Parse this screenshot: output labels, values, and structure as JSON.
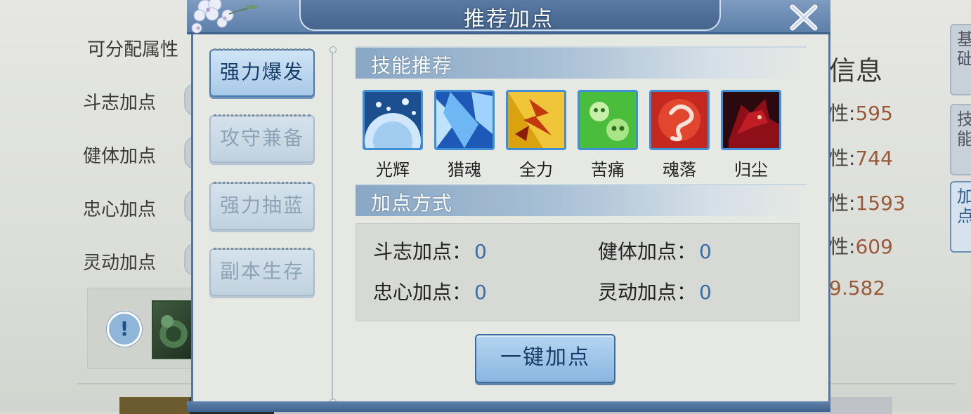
{
  "background": {
    "left_header": "可分配属性",
    "labels": [
      "斗志加点",
      "健体加点",
      "忠心加点",
      "灵动加点"
    ],
    "info_title": "信息",
    "stats": [
      {
        "prefix": "性:",
        "value": "595"
      },
      {
        "prefix": "性:",
        "value": "744"
      },
      {
        "prefix": "性:",
        "value": "1593"
      },
      {
        "prefix": "性:",
        "value": "609"
      },
      {
        "prefix": "",
        "value": "9.582"
      }
    ],
    "right_tabs": [
      "基础",
      "技能",
      "加点"
    ],
    "warning_glyph": "!"
  },
  "modal": {
    "title": "推荐加点",
    "close_icon": "close-x-icon",
    "presets": [
      {
        "label": "强力爆发",
        "selected": true
      },
      {
        "label": "攻守兼备",
        "selected": false
      },
      {
        "label": "强力抽蓝",
        "selected": false
      },
      {
        "label": "副本生存",
        "selected": false
      }
    ],
    "skills_section_title": "技能推荐",
    "skills": [
      {
        "name": "光辉",
        "icon": "radiance-orb-icon"
      },
      {
        "name": "猎魂",
        "icon": "ice-shard-icon"
      },
      {
        "name": "全力",
        "icon": "lightning-strike-icon"
      },
      {
        "name": "苦痛",
        "icon": "poison-skull-icon"
      },
      {
        "name": "魂落",
        "icon": "soul-swirl-icon"
      },
      {
        "name": "归尘",
        "icon": "shadow-wolf-icon"
      }
    ],
    "points_section_title": "加点方式",
    "points": [
      {
        "label": "斗志加点：",
        "value": "0"
      },
      {
        "label": "健体加点：",
        "value": "0"
      },
      {
        "label": "忠心加点：",
        "value": "0"
      },
      {
        "label": "灵动加点：",
        "value": "0"
      }
    ],
    "apply_button": "一键加点"
  },
  "colors": {
    "frame_blue": "#5c7fa9",
    "skill_border": "#3f8fd6",
    "stat_value": "#9a5a3a",
    "point_value": "#3a6ea6"
  }
}
